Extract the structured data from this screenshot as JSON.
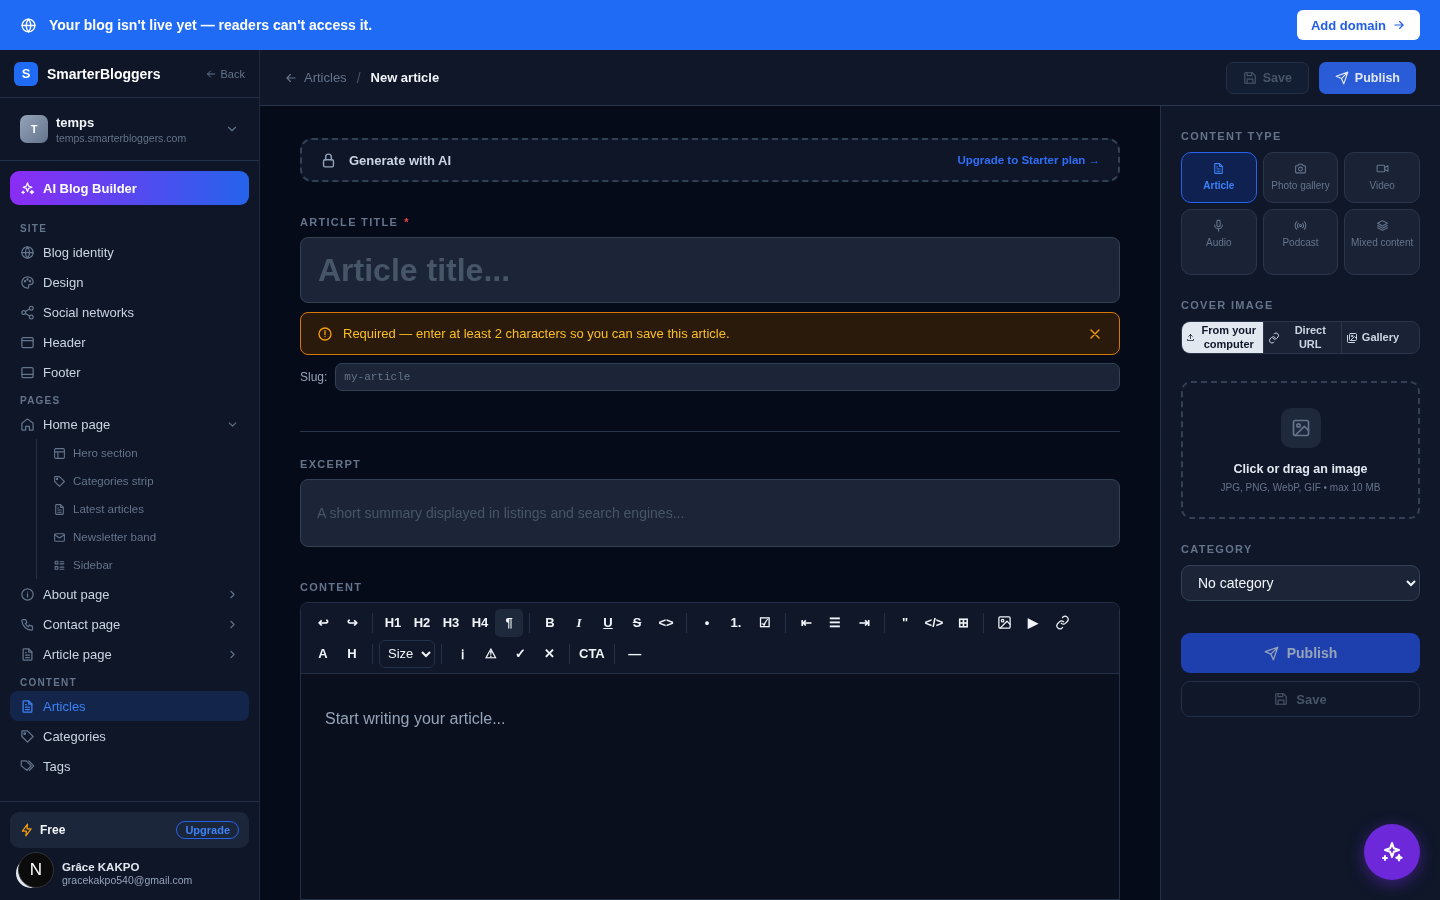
{
  "banner": {
    "message": "Your blog isn't live yet — readers can't access it.",
    "button": "Add domain"
  },
  "sidebar": {
    "brand": {
      "logo": "S",
      "name": "SmarterBloggers",
      "back": "Back"
    },
    "account": {
      "avatar": "T",
      "name": "temps",
      "domain": "temps.smarterbloggers.com"
    },
    "ai_button": "AI Blog Builder",
    "sections": [
      {
        "title": "SITE",
        "items": [
          {
            "label": "Blog identity",
            "selected": false
          },
          {
            "label": "Design",
            "selected": false
          },
          {
            "label": "Social networks",
            "selected": false
          },
          {
            "label": "Header",
            "selected": false
          },
          {
            "label": "Footer",
            "selected": false
          }
        ]
      },
      {
        "title": "PAGES",
        "items": [
          {
            "label": "Home page",
            "selected": false,
            "expanded": true,
            "children": [
              {
                "label": "Hero section"
              },
              {
                "label": "Categories strip"
              },
              {
                "label": "Latest articles"
              },
              {
                "label": "Newsletter band"
              },
              {
                "label": "Sidebar"
              }
            ]
          },
          {
            "label": "About page",
            "selected": false,
            "expanded": false
          },
          {
            "label": "Contact page",
            "selected": false,
            "expanded": false
          },
          {
            "label": "Article page",
            "selected": false,
            "expanded": false
          }
        ]
      },
      {
        "title": "CONTENT",
        "items": [
          {
            "label": "Articles",
            "selected": true
          },
          {
            "label": "Categories",
            "selected": false
          },
          {
            "label": "Tags",
            "selected": false
          }
        ]
      }
    ],
    "plan": {
      "name": "Free",
      "button": "Upgrade"
    },
    "user": {
      "name": "Grâce KAKPO",
      "email": "gracekakpo540@gmail.com",
      "badge": "N"
    }
  },
  "header": {
    "breadcrumb": [
      {
        "label": "Articles"
      },
      {
        "label": "New article"
      }
    ],
    "breadcrumb_separator": "/",
    "save": {
      "label": "Save",
      "disabled": true
    },
    "publish": "Publish"
  },
  "form": {
    "ai_generate": {
      "label": "Generate with AI",
      "link": "Upgrade to Starter plan →"
    },
    "title_field": {
      "label": "ARTICLE TITLE",
      "required_mark": "*",
      "placeholder": "Article title..."
    },
    "error": {
      "message": "Required — enter at least 2 characters so you can save this article."
    },
    "slug": {
      "label": "Slug:",
      "placeholder": "my-article"
    },
    "excerpt": {
      "label": "EXCERPT",
      "placeholder": "A short summary displayed in listings and search engines..."
    },
    "content": {
      "label": "CONTENT",
      "toolbar": [
        [
          [
            {
              "kind": "text",
              "label": "↩",
              "selected": false
            },
            {
              "kind": "text",
              "label": "↪",
              "selected": false
            }
          ],
          [
            {
              "kind": "text",
              "label": "H1",
              "selected": false
            },
            {
              "kind": "text",
              "label": "H2",
              "selected": false
            },
            {
              "kind": "text",
              "label": "H3",
              "selected": false
            },
            {
              "kind": "text",
              "label": "H4",
              "selected": false
            },
            {
              "kind": "text",
              "label": "¶",
              "selected": true
            }
          ],
          [
            {
              "kind": "bold",
              "label": "B",
              "selected": false
            },
            {
              "kind": "italic",
              "label": "I",
              "selected": false
            },
            {
              "kind": "underline",
              "label": "U",
              "selected": false
            },
            {
              "kind": "strike",
              "label": "S",
              "selected": false
            },
            {
              "kind": "text",
              "label": "<>",
              "selected": false
            }
          ],
          [
            {
              "kind": "text",
              "label": "•",
              "selected": false
            },
            {
              "kind": "text",
              "label": "1.",
              "selected": false
            },
            {
              "kind": "text",
              "label": "☑",
              "selected": false
            }
          ],
          [
            {
              "kind": "text",
              "label": "⇤",
              "selected": false
            },
            {
              "kind": "text",
              "label": "☰",
              "selected": false
            },
            {
              "kind": "text",
              "label": "⇥",
              "selected": false
            }
          ],
          [
            {
              "kind": "text",
              "label": "\"",
              "selected": false
            },
            {
              "kind": "text",
              "label": "</>",
              "selected": false
            },
            {
              "kind": "text",
              "label": "⊞",
              "selected": false
            }
          ],
          [
            {
              "kind": "image",
              "selected": false
            },
            {
              "kind": "text",
              "label": "▶",
              "selected": false
            },
            {
              "kind": "link",
              "selected": false
            }
          ]
        ],
        [
          [
            {
              "kind": "text",
              "label": "A",
              "selected": false
            },
            {
              "kind": "text",
              "label": "H",
              "selected": false
            }
          ],
          [
            {
              "kind": "select",
              "label": "Size"
            }
          ],
          [
            {
              "kind": "text",
              "label": "ℹ",
              "selected": false
            },
            {
              "kind": "text",
              "label": "⚠",
              "selected": false
            },
            {
              "kind": "text",
              "label": "✓",
              "selected": false
            },
            {
              "kind": "text",
              "label": "✕",
              "selected": false
            }
          ],
          [
            {
              "kind": "text",
              "label": "CTA",
              "selected": false
            }
          ],
          [
            {
              "kind": "text",
              "label": "—",
              "selected": false
            }
          ]
        ]
      ],
      "placeholder": "Start writing your article..."
    }
  },
  "panel": {
    "content_type": {
      "label": "CONTENT TYPE",
      "options": [
        {
          "label": "Article",
          "selected": true
        },
        {
          "label": "Photo gallery",
          "selected": false
        },
        {
          "label": "Video",
          "selected": false
        },
        {
          "label": "Audio",
          "selected": false
        },
        {
          "label": "Podcast",
          "selected": false
        },
        {
          "label": "Mixed content",
          "selected": false
        }
      ]
    },
    "cover_image": {
      "label": "COVER IMAGE",
      "sources": [
        {
          "label": "From your computer",
          "selected": true
        },
        {
          "label": "Direct URL",
          "selected": false
        },
        {
          "label": "Gallery",
          "selected": false
        }
      ],
      "dropzone": {
        "title": "Click or drag an image",
        "hint": "JPG, PNG, WebP, GIF • max 10 MB"
      }
    },
    "category": {
      "label": "CATEGORY",
      "value": "No category"
    },
    "publish": {
      "label": "Publish",
      "disabled": true
    },
    "save": {
      "label": "Save",
      "disabled": true
    }
  }
}
